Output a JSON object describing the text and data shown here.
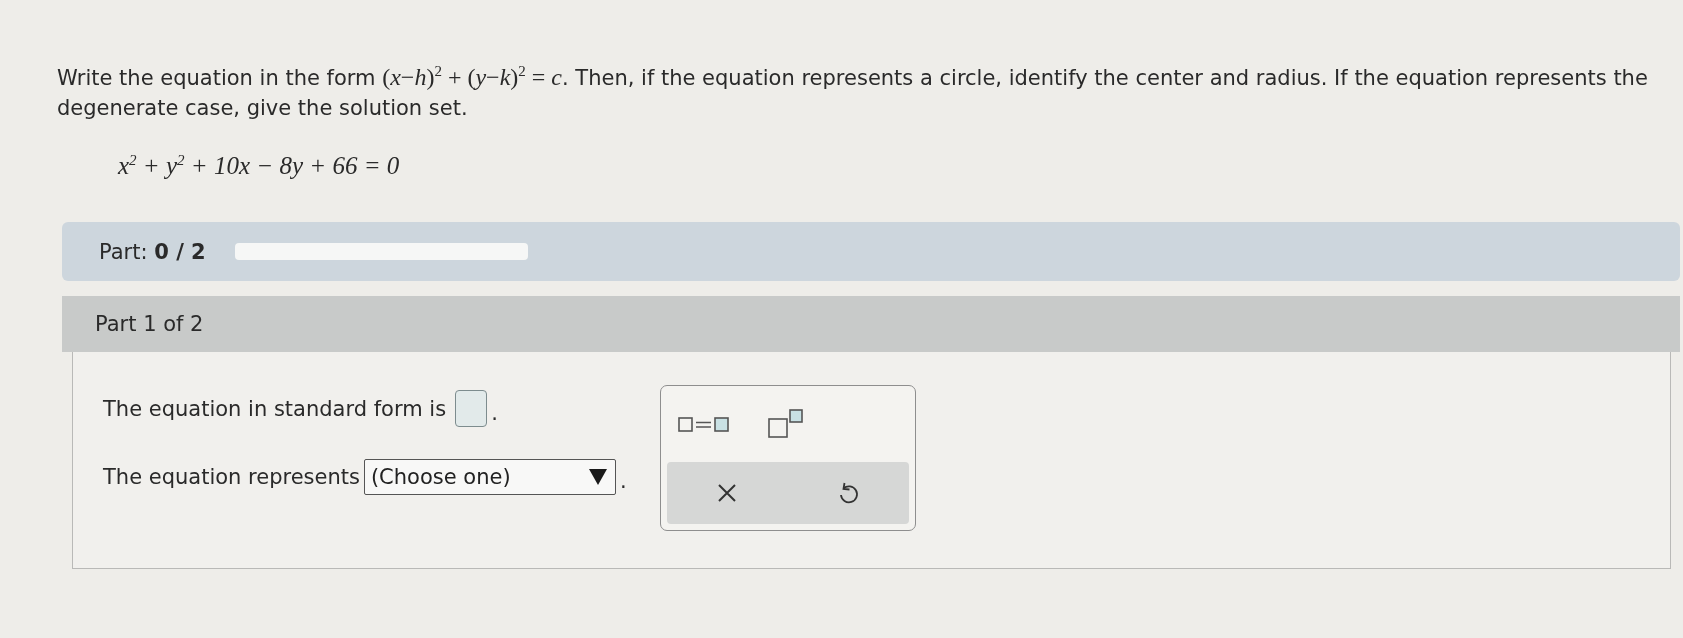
{
  "instruction": [
    {
      "kind": "text",
      "text": "Write the equation in the form "
    },
    {
      "kind": "math",
      "text": "(*x*−*h*)$^{2}$ + (*y*−*k*)$^{2}$ = *c*"
    },
    {
      "kind": "text",
      "text": ". Then, if the equation represents a circle, identify the center and radius. If the equation represents the degenerate case, give the solution set."
    }
  ],
  "equation": "x$^{2}$ + y$^{2}$ + 10x − 8y + 66 = 0",
  "progress": {
    "label": "Part: **0 / 2**"
  },
  "part_header": "Part 1 of 2",
  "questions": [
    {
      "kind": "answer_box",
      "prompt": "The equation in standard form is",
      "suffix": "."
    },
    {
      "kind": "dropdown",
      "prompt": "The equation represents",
      "value": "(Choose one)",
      "suffix": "."
    }
  ]
}
